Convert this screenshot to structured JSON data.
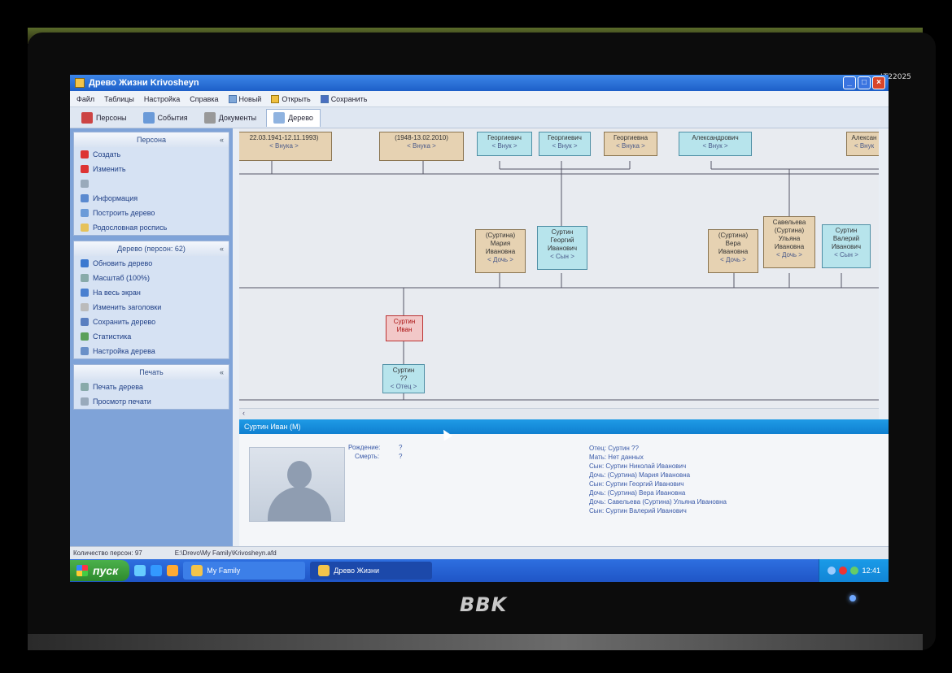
{
  "monitor": {
    "model": "LT22025",
    "brand": "BBK"
  },
  "window": {
    "title": "Древо Жизни  Krivosheyn",
    "menu": [
      "Файл",
      "Таблицы",
      "Настройка",
      "Справка"
    ],
    "toolbar": {
      "new_label": "Новый",
      "open_label": "Открыть",
      "save_label": "Сохранить"
    },
    "tabs": [
      {
        "label": "Персоны",
        "icon": "persons-icon"
      },
      {
        "label": "События",
        "icon": "events-icon"
      },
      {
        "label": "Документы",
        "icon": "documents-icon"
      },
      {
        "label": "Дерево",
        "icon": "tree-icon"
      }
    ]
  },
  "sidebar": {
    "persona": {
      "title": "Персона",
      "items": [
        "Создать",
        "Изменить",
        "",
        "Информация",
        "Построить дерево",
        "Родословная роспись"
      ]
    },
    "tree": {
      "title": "Дерево (персон: 62)",
      "items": [
        "Обновить дерево",
        "Масштаб (100%)",
        "На весь экран",
        "Изменить заголовки",
        "Сохранить дерево",
        "Статистика",
        "Настройка дерева"
      ]
    },
    "print": {
      "title": "Печать",
      "items": [
        "Печать дерева",
        "Просмотр печати"
      ]
    }
  },
  "tree_nodes": {
    "n1": {
      "text": "22.03.1941-12.11.1993)",
      "rel": "< Внука >"
    },
    "n2": {
      "text": "(1948-13.02.2010)",
      "rel": "< Внука >"
    },
    "n3": {
      "text": "Георгиевич",
      "rel": "< Внук >"
    },
    "n4": {
      "text": "Георгиевич",
      "rel": "< Внук >"
    },
    "n5": {
      "text": "Георгиевна",
      "rel": "< Внука >"
    },
    "n6": {
      "text": "Александрович",
      "rel": "< Внук >"
    },
    "n7": {
      "text": "Алексан",
      "rel": "< Внук"
    },
    "n8": {
      "lines": [
        "(Суртина)",
        "Мария",
        "Ивановна"
      ],
      "rel": "< Дочь >"
    },
    "n9": {
      "lines": [
        "Суртин",
        "Георгий",
        "Иванович"
      ],
      "rel": "< Сын >"
    },
    "n10": {
      "lines": [
        "(Суртина)",
        "Вера",
        "Ивановна"
      ],
      "rel": "< Дочь >"
    },
    "n11": {
      "lines": [
        "Савельева",
        "(Суртина)",
        "Ульяна",
        "Ивановна"
      ],
      "rel": "< Дочь >"
    },
    "n12": {
      "lines": [
        "Суртин",
        "Валерий",
        "Иванович"
      ],
      "rel": "< Сын >"
    },
    "n13": {
      "lines": [
        "Суртин",
        "Иван"
      ]
    },
    "n14": {
      "lines": [
        "Суртин",
        "??"
      ],
      "rel": "< Отец >"
    }
  },
  "details": {
    "header": "Суртин Иван (М)",
    "born_label": "Рождение:",
    "born_value": "?",
    "death_label": "Смерть:",
    "death_value": "?",
    "relatives": [
      "Отец: Суртин ??",
      "Мать: Нет данных",
      "Сын: Суртин Николай Иванович",
      "Дочь: (Суртина) Мария Ивановна",
      "Сын: Суртин Георгий Иванович",
      "Дочь: (Суртина) Вера Ивановна",
      "Дочь: Савельева (Суртина) Ульяна Ивановна",
      "Сын: Суртин Валерий Иванович"
    ]
  },
  "status": {
    "count": "Количество персон: 97",
    "path": "E:\\Drevo\\My Family\\Krivosheyn.afd"
  },
  "taskbar": {
    "start": "пуск",
    "tasks": [
      "My Family",
      "Древо Жизни"
    ],
    "clock": "12:41"
  }
}
